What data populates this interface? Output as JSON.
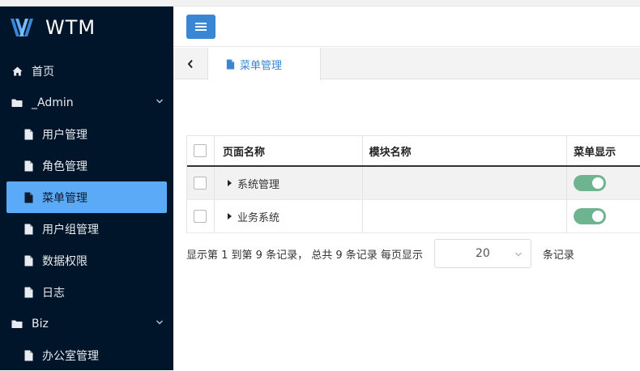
{
  "app": {
    "brand": "WTM"
  },
  "sidebar": {
    "items": [
      {
        "label": "首页",
        "icon": "home-icon"
      },
      {
        "label": "_Admin",
        "icon": "folder-icon"
      },
      {
        "label": "用户管理",
        "icon": "file-icon"
      },
      {
        "label": "角色管理",
        "icon": "file-icon"
      },
      {
        "label": "菜单管理",
        "icon": "file-icon",
        "active": true
      },
      {
        "label": "用户组管理",
        "icon": "file-icon"
      },
      {
        "label": "数据权限",
        "icon": "file-icon"
      },
      {
        "label": "日志",
        "icon": "file-icon"
      },
      {
        "label": "Biz",
        "icon": "folder-icon"
      },
      {
        "label": "办公室管理",
        "icon": "file-icon"
      }
    ]
  },
  "tabs": [
    {
      "label": "菜单管理",
      "icon": "file-icon"
    }
  ],
  "table": {
    "columns": [
      "页面名称",
      "模块名称",
      "菜单显示"
    ],
    "rows": [
      {
        "name": "系统管理",
        "module": "",
        "show": true
      },
      {
        "name": "业务系统",
        "module": "",
        "show": true
      }
    ]
  },
  "pager": {
    "info": "显示第 1 到第 9 条记录， 总共 9 条记录 每页显示",
    "page_size": "20",
    "suffix": "条记录"
  },
  "colors": {
    "sidebar_bg": "#001529",
    "active_bg": "#5aaaf8",
    "accent": "#3a86d4",
    "toggle_on": "#6fb491"
  }
}
